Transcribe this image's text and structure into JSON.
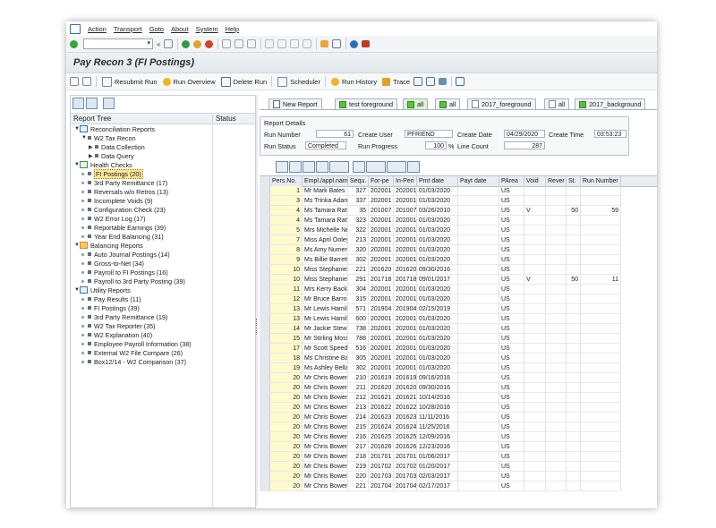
{
  "menu": [
    "Action",
    "Transport",
    "Goto",
    "About",
    "System",
    "Help"
  ],
  "title": "Pay Recon 3 (FI Postings)",
  "app_toolbar": [
    {
      "label": "Resubmit Run",
      "icon": "resubmit-icon"
    },
    {
      "label": "Run Overview",
      "icon": "run-overview-icon"
    },
    {
      "label": "Delete Run",
      "icon": "trash-icon"
    },
    {
      "label": "Scheduler",
      "icon": "scheduler-icon"
    },
    {
      "label": "Run History",
      "icon": "history-icon"
    },
    {
      "label": "Trace",
      "icon": "trace-icon"
    }
  ],
  "tree": {
    "header": {
      "col1": "Report Tree",
      "col2": "Status"
    },
    "items": [
      {
        "label": "Reconciliation Reports",
        "level": 0,
        "type": "folder",
        "toggle": "▼"
      },
      {
        "label": "W2 Tax Recon",
        "level": 1,
        "type": "node",
        "toggle": "▼"
      },
      {
        "label": "Data Collection",
        "level": 2,
        "type": "node",
        "toggle": "▶"
      },
      {
        "label": "Data Query",
        "level": 2,
        "type": "node",
        "toggle": "▶"
      },
      {
        "label": "Health Checks",
        "level": 0,
        "type": "check",
        "toggle": "▼"
      },
      {
        "label": "FI Postings (20)",
        "level": 1,
        "type": "leaf",
        "selected": true
      },
      {
        "label": "3rd Party Remittance (17)",
        "level": 1,
        "type": "leaf"
      },
      {
        "label": "Reversals w/o Retros (13)",
        "level": 1,
        "type": "leaf"
      },
      {
        "label": "Incomplete Voids (9)",
        "level": 1,
        "type": "leaf"
      },
      {
        "label": "Configuration Check (23)",
        "level": 1,
        "type": "leaf"
      },
      {
        "label": "W2 Error Log (17)",
        "level": 1,
        "type": "leaf"
      },
      {
        "label": "Reportable Earnings (39)",
        "level": 1,
        "type": "leaf"
      },
      {
        "label": "Year End Balancing (31)",
        "level": 1,
        "type": "leaf"
      },
      {
        "label": "Balancing Reports",
        "level": 0,
        "type": "balance",
        "toggle": "▼"
      },
      {
        "label": "Auto Journal Postings (14)",
        "level": 1,
        "type": "leaf"
      },
      {
        "label": "Gross-to-Net (34)",
        "level": 1,
        "type": "leaf"
      },
      {
        "label": "Payroll to FI Postings (16)",
        "level": 1,
        "type": "leaf"
      },
      {
        "label": "Payroll to 3rd Party Posting (39)",
        "level": 1,
        "type": "leaf"
      },
      {
        "label": "Utility Reports",
        "level": 0,
        "type": "utility",
        "toggle": "▼"
      },
      {
        "label": "Pay Results (11)",
        "level": 1,
        "type": "leaf"
      },
      {
        "label": "FI Postings (39)",
        "level": 1,
        "type": "leaf"
      },
      {
        "label": "3rd Party Remittance (19)",
        "level": 1,
        "type": "leaf"
      },
      {
        "label": "W2 Tax Reporter (35)",
        "level": 1,
        "type": "leaf"
      },
      {
        "label": "W2 Explanation (40)",
        "level": 1,
        "type": "leaf"
      },
      {
        "label": "Employee Payroll Information (38)",
        "level": 1,
        "type": "leaf"
      },
      {
        "label": "External W2 File Compare (26)",
        "level": 1,
        "type": "leaf"
      },
      {
        "label": "Box12/14 - W2 Comparison (37)",
        "level": 1,
        "type": "leaf"
      }
    ]
  },
  "tabs": [
    {
      "label": "New Report",
      "icon": "page"
    },
    {
      "label": "test foreground",
      "icon": "green"
    },
    {
      "label": "all",
      "icon": "green",
      "active": true
    },
    {
      "label": "all",
      "icon": "green"
    },
    {
      "label": "2017_foreground",
      "icon": "share"
    },
    {
      "label": "all",
      "icon": "share"
    },
    {
      "label": "2017_background",
      "icon": "green"
    }
  ],
  "report_details": {
    "title": "Report Details",
    "run_number_label": "Run Number",
    "run_number": "61",
    "create_user_label": "Create User",
    "create_user": "PFRIEND",
    "create_date_label": "Create Date",
    "create_date": "04/29/2020",
    "create_time_label": "Create Time",
    "create_time": "03:53:23",
    "run_status_label": "Run Status",
    "run_status": "Completed",
    "run_progress_label": "Run Progress",
    "run_progress": "100",
    "percent": "%",
    "line_count_label": "Line Count",
    "line_count": "287"
  },
  "grid": {
    "columns": [
      "Pers.No.",
      "Empl./appl.name",
      "Sequ.",
      "For-pe",
      "In-Peri",
      "Pmt date",
      "Payt date",
      "PArea",
      "Void",
      "Rever",
      "St.",
      "Run Number"
    ],
    "rows": [
      [
        "1",
        "Mr Mark Bates",
        "327",
        "202001",
        "202001",
        "01/03/2020",
        "",
        "US",
        "",
        "",
        "",
        ""
      ],
      [
        "3",
        "Ms Trinka Adams_",
        "337",
        "202001",
        "202001",
        "01/03/2020",
        "",
        "US",
        "",
        "",
        "",
        ""
      ],
      [
        "4",
        "Ms Tamara Rattray",
        "35",
        "201007",
        "201007",
        "03/26/2010",
        "",
        "US",
        "V",
        "",
        "50",
        "59"
      ],
      [
        "4",
        "Ms Tamara Rattray",
        "323",
        "202001",
        "202001",
        "01/03/2020",
        "",
        "US",
        "",
        "",
        "",
        ""
      ],
      [
        "5",
        "Mrs Michelle New_",
        "322",
        "202001",
        "202001",
        "01/03/2020",
        "",
        "US",
        "",
        "",
        "",
        ""
      ],
      [
        "7",
        "Miss April Ooley",
        "213",
        "202001",
        "202001",
        "01/03/2020",
        "",
        "US",
        "",
        "",
        "",
        ""
      ],
      [
        "8",
        "Ms Amy Numema_",
        "320",
        "202001",
        "202001",
        "01/03/2020",
        "",
        "US",
        "",
        "",
        "",
        ""
      ],
      [
        "9",
        "Ms Billie Barrett",
        "302",
        "202001",
        "202001",
        "01/03/2020",
        "",
        "US",
        "",
        "",
        "",
        ""
      ],
      [
        "10",
        "Miss Stephanie A_",
        "221",
        "201620",
        "201620",
        "09/30/2016",
        "",
        "US",
        "",
        "",
        "",
        ""
      ],
      [
        "10",
        "Miss Stephanie A_",
        "291",
        "201718",
        "201718",
        "09/01/2017",
        "",
        "US",
        "V",
        "",
        "50",
        "11"
      ],
      [
        "11",
        "Mrs Kerry Backsen",
        "304",
        "202001",
        "202001",
        "01/03/2020",
        "",
        "US",
        "",
        "",
        "",
        ""
      ],
      [
        "12",
        "Mr Bruce Barron",
        "315",
        "202001",
        "202001",
        "01/03/2020",
        "",
        "US",
        "",
        "",
        "",
        ""
      ],
      [
        "13",
        "Mr Lewis Hamilton",
        "571",
        "201904",
        "201904",
        "02/15/2019",
        "",
        "US",
        "",
        "",
        "",
        ""
      ],
      [
        "13",
        "Mr Lewis Hamilton",
        "600",
        "202001",
        "202001",
        "01/03/2020",
        "",
        "US",
        "",
        "",
        "",
        ""
      ],
      [
        "14",
        "Mr Jackie Stewart",
        "738",
        "202001",
        "202001",
        "01/03/2020",
        "",
        "US",
        "",
        "",
        "",
        ""
      ],
      [
        "15",
        "Mr Stirling Moss",
        "788",
        "202001",
        "202001",
        "01/03/2020",
        "",
        "US",
        "",
        "",
        "",
        ""
      ],
      [
        "17",
        "Mr Scott Speed",
        "516",
        "202001",
        "202001",
        "01/03/2020",
        "",
        "US",
        "",
        "",
        "",
        ""
      ],
      [
        "18",
        "Ms Christine Bayha",
        "305",
        "202001",
        "202001",
        "01/03/2020",
        "",
        "US",
        "",
        "",
        "",
        ""
      ],
      [
        "19",
        "Ms Ashley Bellard",
        "302",
        "202001",
        "202001",
        "01/03/2020",
        "",
        "US",
        "",
        "",
        "",
        ""
      ],
      [
        "20",
        "Mr Chris Bowen",
        "210",
        "201619",
        "201619",
        "09/16/2016",
        "",
        "US",
        "",
        "",
        "",
        ""
      ],
      [
        "20",
        "Mr Chris Bowen",
        "211",
        "201620",
        "201620",
        "09/30/2016",
        "",
        "US",
        "",
        "",
        "",
        ""
      ],
      [
        "20",
        "Mr Chris Bowen",
        "212",
        "201621",
        "201621",
        "10/14/2016",
        "",
        "US",
        "",
        "",
        "",
        ""
      ],
      [
        "20",
        "Mr Chris Bowen",
        "213",
        "201622",
        "201622",
        "10/28/2016",
        "",
        "US",
        "",
        "",
        "",
        ""
      ],
      [
        "20",
        "Mr Chris Bowen",
        "214",
        "201623",
        "201623",
        "11/11/2016",
        "",
        "US",
        "",
        "",
        "",
        ""
      ],
      [
        "20",
        "Mr Chris Bowen",
        "215",
        "201624",
        "201624",
        "11/25/2016",
        "",
        "US",
        "",
        "",
        "",
        ""
      ],
      [
        "20",
        "Mr Chris Bowen",
        "216",
        "201625",
        "201625",
        "12/09/2016",
        "",
        "US",
        "",
        "",
        "",
        ""
      ],
      [
        "20",
        "Mr Chris Bowen",
        "217",
        "201626",
        "201626",
        "12/23/2016",
        "",
        "US",
        "",
        "",
        "",
        ""
      ],
      [
        "20",
        "Mr Chris Bowen",
        "218",
        "201701",
        "201701",
        "01/06/2017",
        "",
        "US",
        "",
        "",
        "",
        ""
      ],
      [
        "20",
        "Mr Chris Bowen",
        "219",
        "201702",
        "201702",
        "01/20/2017",
        "",
        "US",
        "",
        "",
        "",
        ""
      ],
      [
        "20",
        "Mr Chris Bowen",
        "220",
        "201703",
        "201703",
        "02/03/2017",
        "",
        "US",
        "",
        "",
        "",
        ""
      ],
      [
        "20",
        "Mr Chris Bowen",
        "221",
        "201704",
        "201704",
        "02/17/2017",
        "",
        "US",
        "",
        "",
        "",
        ""
      ]
    ]
  },
  "colors": {
    "accent": "#2a6fbf",
    "selection": "#fde79a",
    "tab_active": "#dff0d4",
    "grid_header": "#e9edf1"
  }
}
